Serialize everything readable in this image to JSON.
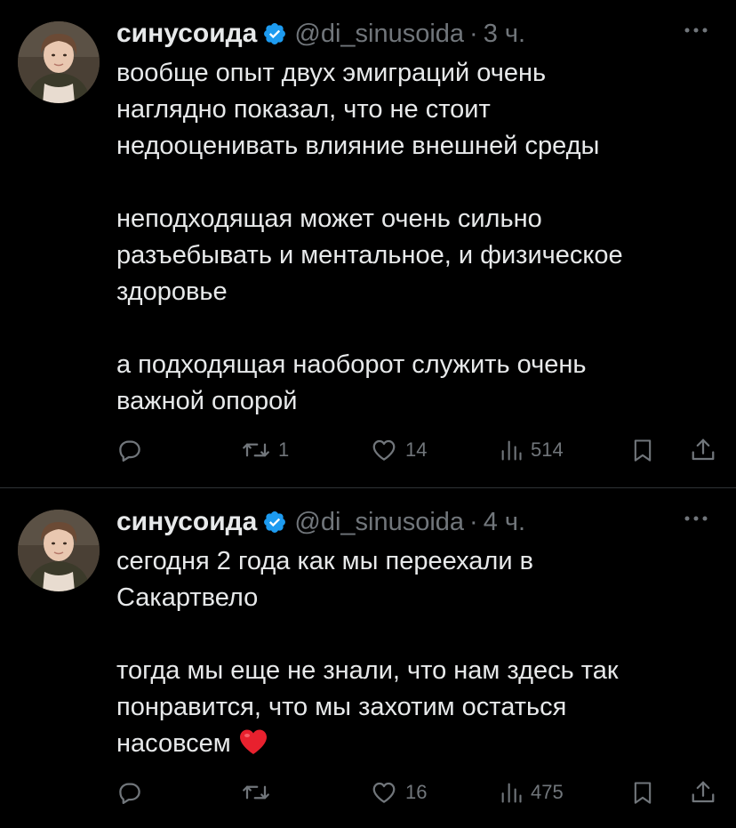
{
  "colors": {
    "background": "#000000",
    "text_primary": "#e7e9ea",
    "text_secondary": "#71767b",
    "verified": "#1d9bf0",
    "divider": "#2f3336",
    "heart_emoji": "#e8212e"
  },
  "tweets": [
    {
      "author": {
        "display_name": "синусоида",
        "handle": "@di_sinusoida",
        "verified_icon": "verified-badge-icon",
        "avatar": "avatar"
      },
      "separator": "·",
      "time": "3 ч.",
      "more_icon": "more-icon",
      "paragraphs": [
        [
          "вообще опыт двух эмиграций очень",
          "наглядно показал, что не стоит",
          "недооценивать влияние внешней среды"
        ],
        [
          "неподходящая может очень сильно",
          "разъебывать и ментальное, и физическое",
          "здоровье"
        ],
        [
          "а подходящая наоборот служить очень",
          "важной опорой"
        ]
      ],
      "actions": {
        "reply_icon": "reply-icon",
        "reply_count": "",
        "retweet_icon": "retweet-icon",
        "retweet_count": "1",
        "like_icon": "like-icon",
        "like_count": "14",
        "views_icon": "views-icon",
        "views_count": "514",
        "bookmark_icon": "bookmark-icon",
        "share_icon": "share-icon"
      }
    },
    {
      "author": {
        "display_name": "синусоида",
        "handle": "@di_sinusoida",
        "verified_icon": "verified-badge-icon",
        "avatar": "avatar"
      },
      "separator": "·",
      "time": "4 ч.",
      "more_icon": "more-icon",
      "paragraphs": [
        [
          "сегодня 2 года как мы переехали в",
          "Сакартвело"
        ],
        [
          "тогда мы еще не знали, что нам здесь так",
          "понравится, что мы захотим остаться",
          "насовсем"
        ]
      ],
      "emoji_icon": "red-heart-emoji-icon",
      "actions": {
        "reply_icon": "reply-icon",
        "reply_count": "",
        "retweet_icon": "retweet-icon",
        "retweet_count": "",
        "like_icon": "like-icon",
        "like_count": "16",
        "views_icon": "views-icon",
        "views_count": "475",
        "bookmark_icon": "bookmark-icon",
        "share_icon": "share-icon"
      }
    }
  ]
}
